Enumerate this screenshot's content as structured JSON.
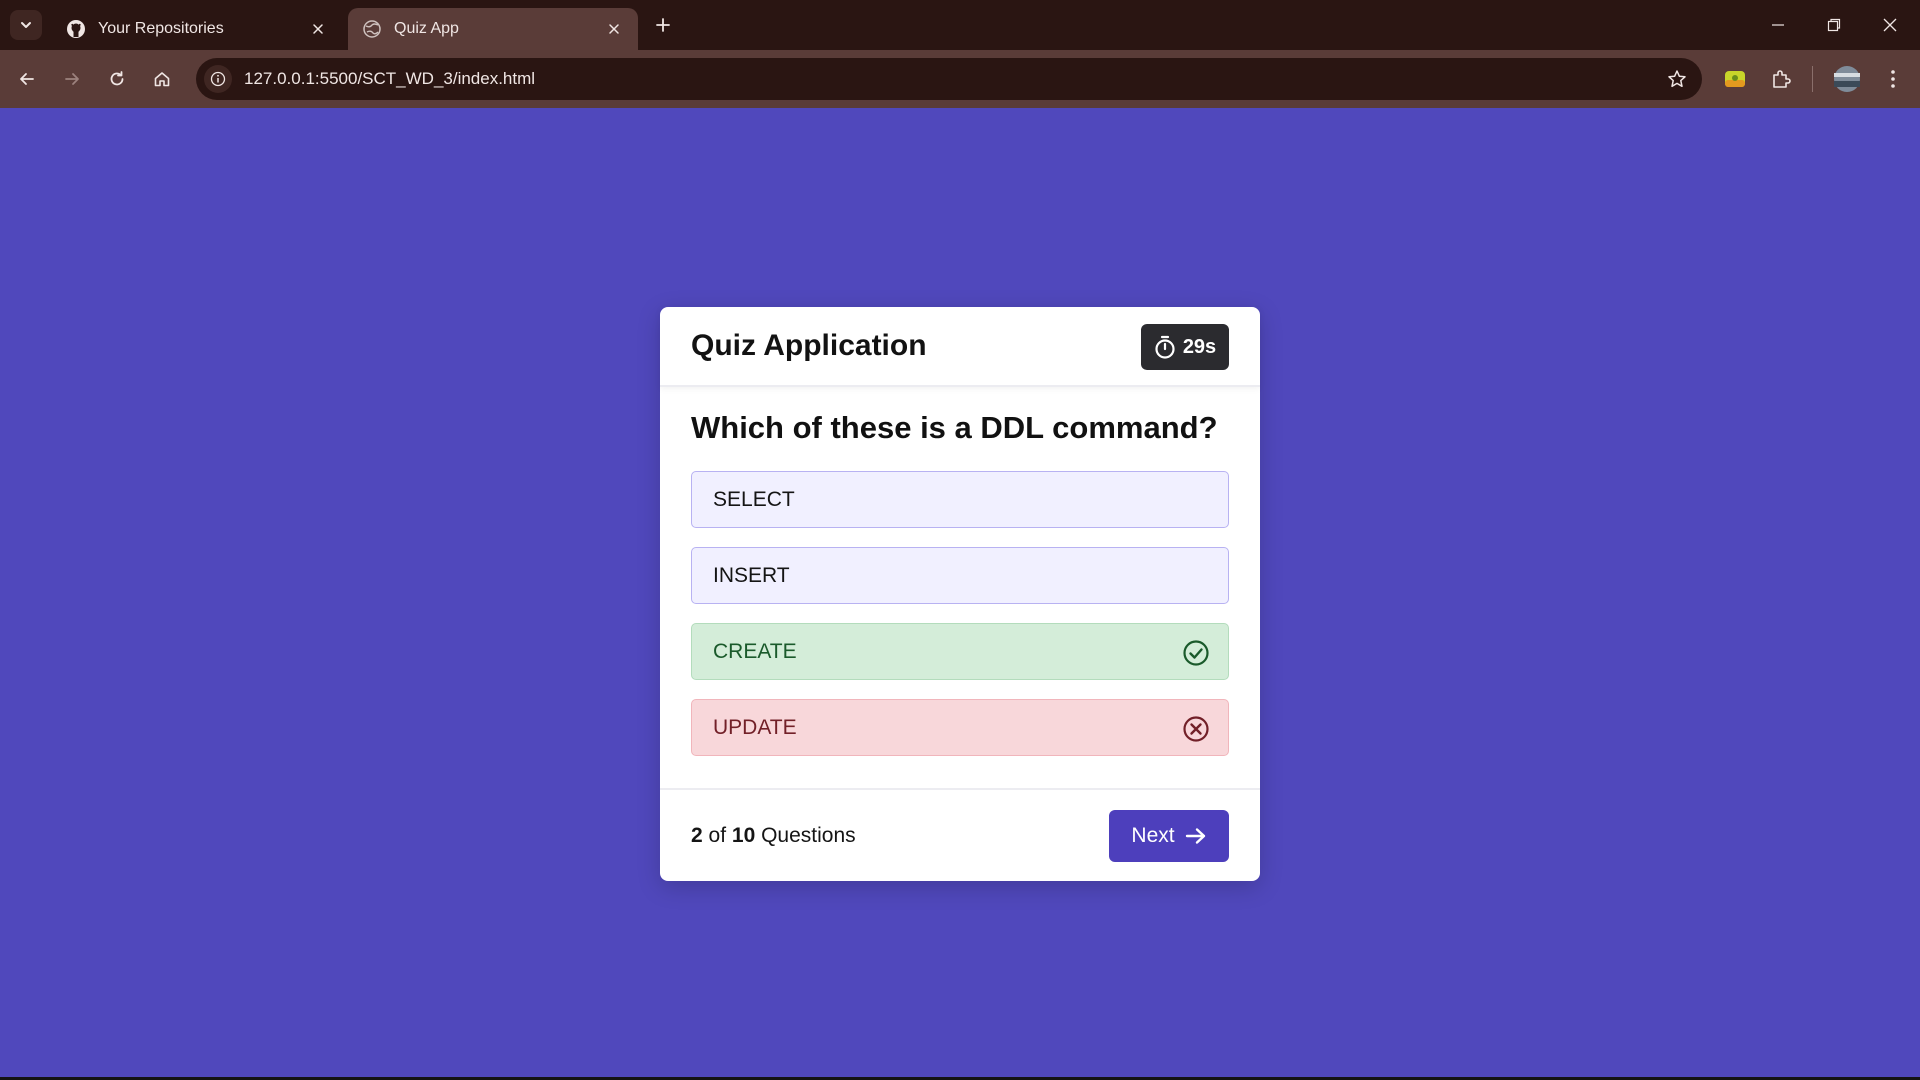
{
  "browser": {
    "tabs": [
      {
        "title": "Your Repositories",
        "favicon": "github-icon",
        "active": false
      },
      {
        "title": "Quiz App",
        "favicon": "globe-icon",
        "active": true
      }
    ],
    "url": "127.0.0.1:5500/SCT_WD_3/index.html"
  },
  "quiz": {
    "app_title": "Quiz Application",
    "timer": "29s",
    "question": "Which of these is a DDL command?",
    "options": [
      {
        "label": "SELECT",
        "state": "neutral"
      },
      {
        "label": "INSERT",
        "state": "neutral"
      },
      {
        "label": "CREATE",
        "state": "correct",
        "icon": "check-circle-icon"
      },
      {
        "label": "UPDATE",
        "state": "wrong",
        "icon": "x-circle-icon"
      }
    ],
    "progress": {
      "current": "2",
      "of_text": "of",
      "total": "10",
      "suffix": "Questions"
    },
    "next_label": "Next"
  },
  "colors": {
    "page_bg": "#5048bc",
    "accent": "#4d3fbc",
    "correct_bg": "#d4edd9",
    "wrong_bg": "#f8d7da",
    "neutral_bg": "#f1f0ff"
  }
}
